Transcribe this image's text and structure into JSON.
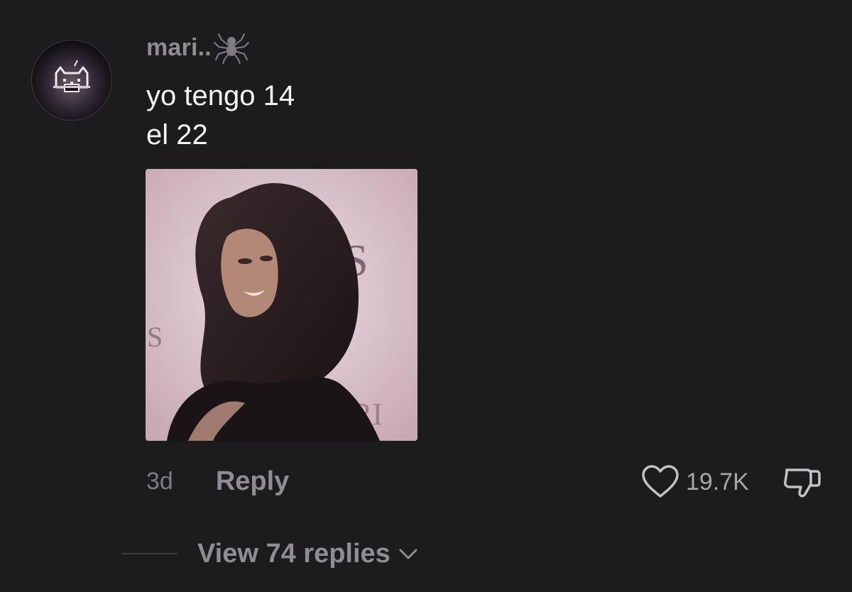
{
  "comment": {
    "username": "mari..",
    "username_icon": "spider-icon",
    "text_lines": [
      "yo tengo 14",
      "el 22"
    ],
    "timestamp": "3d",
    "reply_label": "Reply",
    "like_icon": "heart-icon",
    "like_count": "19.7K",
    "dislike_icon": "thumbs-down-icon",
    "view_replies_label": "View 74 replies",
    "view_replies_icon": "chevron-down-icon"
  },
  "colors": {
    "background": "#1c1b1d",
    "primary_text": "#f4f3f5",
    "secondary_text": "#8f8d92",
    "muted_text": "#7e7c82"
  }
}
